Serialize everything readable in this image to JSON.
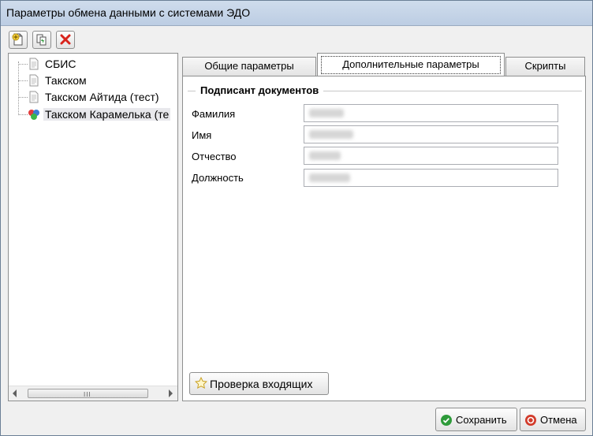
{
  "window": {
    "title": "Параметры обмена данными с системами ЭДО"
  },
  "toolbar": {
    "add": {
      "icon": "add-document-icon"
    },
    "copy": {
      "icon": "copy-document-icon"
    },
    "delete": {
      "icon": "delete-icon"
    }
  },
  "tree": {
    "items": [
      {
        "label": "СБИС",
        "icon": "document-icon"
      },
      {
        "label": "Такском",
        "icon": "document-icon"
      },
      {
        "label": "Такском Айтида (тест)",
        "icon": "document-icon"
      },
      {
        "label": "Такском Карамелька (те",
        "icon": "colored-circles-icon",
        "selected": true
      }
    ],
    "scroll_grip": "III"
  },
  "tabs": [
    {
      "label": "Общие параметры"
    },
    {
      "label": "Дополнительные параметры",
      "active": true
    },
    {
      "label": "Скрипты"
    }
  ],
  "signer": {
    "title": "Подписант документов",
    "fields": [
      {
        "label": "Фамилия"
      },
      {
        "label": "Имя"
      },
      {
        "label": "Отчество"
      },
      {
        "label": "Должность"
      }
    ]
  },
  "check_incoming": {
    "label": "Проверка входящих",
    "icon": "star-icon"
  },
  "footer": {
    "save": {
      "label": "Сохранить",
      "icon": "check-circle-icon"
    },
    "cancel": {
      "label": "Отмена",
      "icon": "cancel-circle-icon"
    }
  },
  "colors": {
    "accent_green": "#2e9b3a",
    "cancel_red": "#d23b2b",
    "delete_red": "#d8231b"
  }
}
